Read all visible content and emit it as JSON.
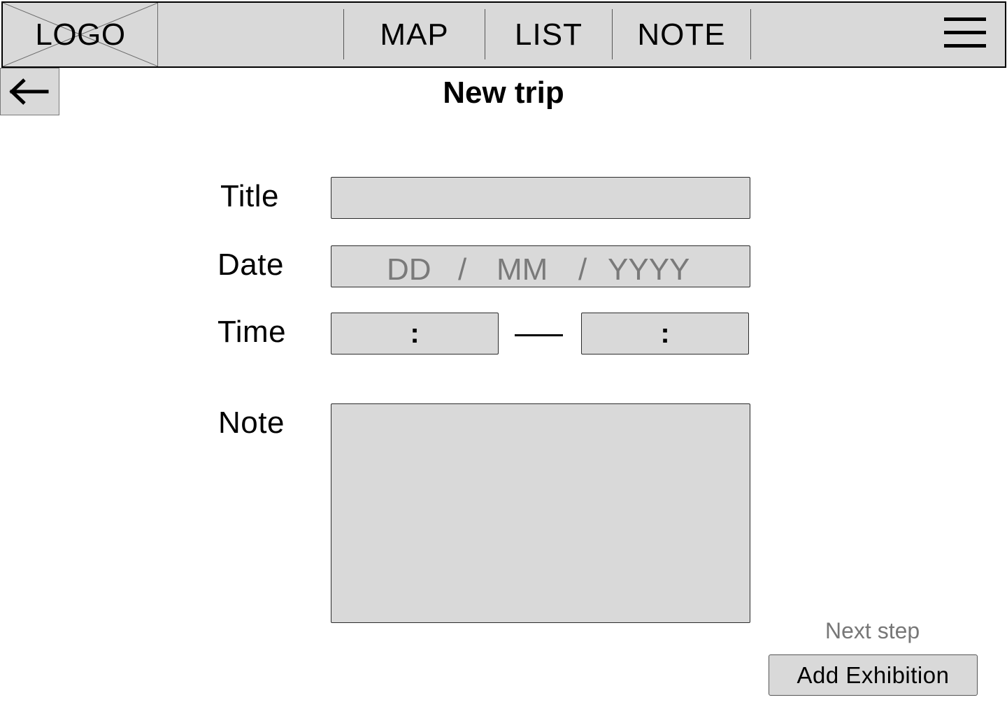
{
  "header": {
    "logo_text": "LOGO",
    "nav": [
      {
        "label": "MAP"
      },
      {
        "label": "LIST"
      },
      {
        "label": "NOTE"
      }
    ],
    "menu_icon": "hamburger-menu-icon"
  },
  "back_icon": "arrow-left-icon",
  "page_title": "New trip",
  "form": {
    "title": {
      "label": "Title",
      "value": ""
    },
    "date": {
      "label": "Date",
      "day_placeholder": "DD",
      "separator": "/",
      "month_placeholder": "MM",
      "year_placeholder": "YYYY"
    },
    "time": {
      "label": "Time",
      "start_separator": ":",
      "end_separator": ":"
    },
    "note": {
      "label": "Note",
      "value": ""
    }
  },
  "next_step": {
    "caption": "Next step",
    "button_label": "Add Exhibition"
  },
  "colors": {
    "field_fill": "#d9d9d9",
    "placeholder": "#7a7a7a",
    "caption": "#777777"
  }
}
